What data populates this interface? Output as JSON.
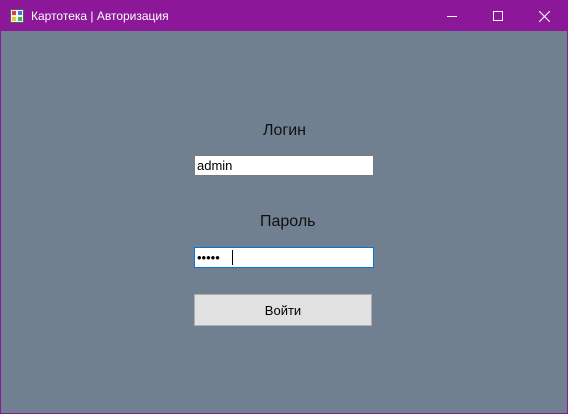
{
  "window": {
    "title": "Картотека | Авторизация",
    "icon": "app-form-icon",
    "controls": [
      "minimize-icon",
      "maximize-icon",
      "close-icon"
    ],
    "colors": {
      "titlebar": "#8c1799",
      "background": "#708090"
    }
  },
  "form": {
    "login_label": "Логин",
    "login_value": "admin",
    "password_label": "Пароль",
    "password_value": "•••••",
    "submit_label": "Войти"
  }
}
